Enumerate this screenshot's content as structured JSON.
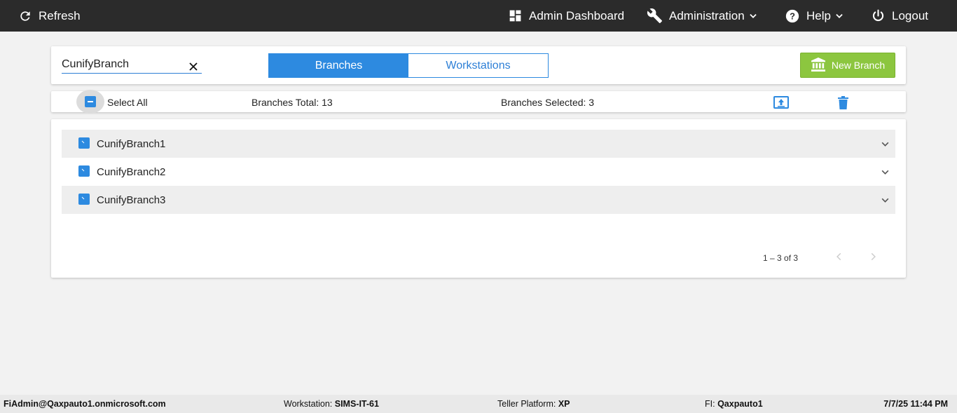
{
  "topbar": {
    "refresh_label": "Refresh",
    "admin_dashboard_label": "Admin Dashboard",
    "administration_label": "Administration",
    "help_label": "Help",
    "logout_label": "Logout",
    "icons": {
      "refresh": "refresh-icon",
      "dashboard": "dashboard-icon",
      "administration": "wrench-icon",
      "help": "help-circle-icon",
      "logout": "power-icon"
    }
  },
  "search": {
    "value": "CunifyBranch",
    "placeholder": ""
  },
  "tabs": [
    {
      "label": "Branches",
      "active": true
    },
    {
      "label": "Workstations",
      "active": false
    }
  ],
  "new_branch_label": "New Branch",
  "toolbar": {
    "select_all_label": "Select All",
    "branches_total": "Branches Total: 13",
    "branches_selected": "Branches Selected: 3"
  },
  "branches": [
    {
      "name": "CunifyBranch1",
      "selected": true
    },
    {
      "name": "CunifyBranch2",
      "selected": true
    },
    {
      "name": "CunifyBranch3",
      "selected": true
    }
  ],
  "pagination": {
    "range_text": "1 – 3 of 3"
  },
  "footer": {
    "user": "FiAdmin@Qaxpauto1.onmicrosoft.com",
    "workstation_label": "Workstation:",
    "workstation_value": "SIMS-IT-61",
    "teller_platform_label": "Teller Platform:",
    "teller_platform_value": "XP",
    "fi_label": "FI:",
    "fi_value": "Qaxpauto1",
    "datetime": "7/7/25 11:44 PM"
  },
  "colors": {
    "topbar_bg": "#2b2b2b",
    "accent_blue": "#2d8ae0",
    "new_branch_green": "#8cc63f",
    "row_shade": "#eeeeee"
  }
}
